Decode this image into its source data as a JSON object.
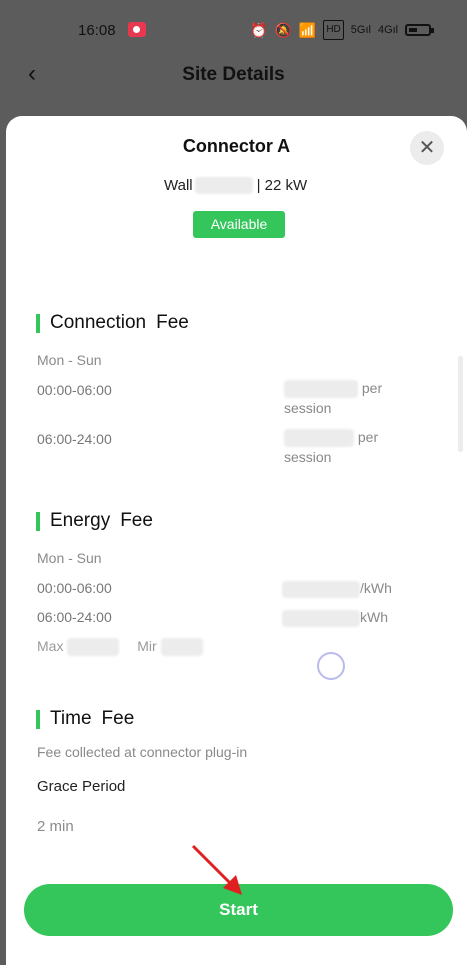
{
  "status_bar": {
    "time": "16:08",
    "icons": [
      "record-icon",
      "alarm-icon",
      "mute-icon",
      "wifi-icon",
      "hd-icon",
      "signal-5g-icon",
      "signal-4g-icon",
      "battery-icon"
    ]
  },
  "header": {
    "title": "Site Details"
  },
  "sheet": {
    "title": "Connector A",
    "subtitle_prefix": "Wall",
    "subtitle_suffix": "| 22 kW",
    "status": "Available",
    "connection_fee": {
      "heading_1": "Connection",
      "heading_2": "Fee",
      "days": "Mon - Sun",
      "rows": [
        {
          "time": "00:00-06:00",
          "price_suffix": "per",
          "price_suffix2": "session"
        },
        {
          "time": "06:00-24:00",
          "price_suffix": "per",
          "price_suffix2": "session"
        }
      ]
    },
    "energy_fee": {
      "heading_1": "Energy",
      "heading_2": "Fee",
      "days": "Mon - Sun",
      "rows": [
        {
          "time": "00:00-06:00",
          "price_suffix": "/kWh"
        },
        {
          "time": "06:00-24:00",
          "price_suffix": "kWh"
        }
      ],
      "max_label": "Max",
      "min_label": "Mir"
    },
    "time_fee": {
      "heading_1": "Time",
      "heading_2": "Fee",
      "note": "Fee collected at connector plug-in",
      "grace_label": "Grace Period",
      "grace_value": "2 min"
    },
    "start_label": "Start"
  },
  "colors": {
    "accent": "#34c55b",
    "overlay": "#5c5c5c",
    "arrow": "#e02020"
  }
}
